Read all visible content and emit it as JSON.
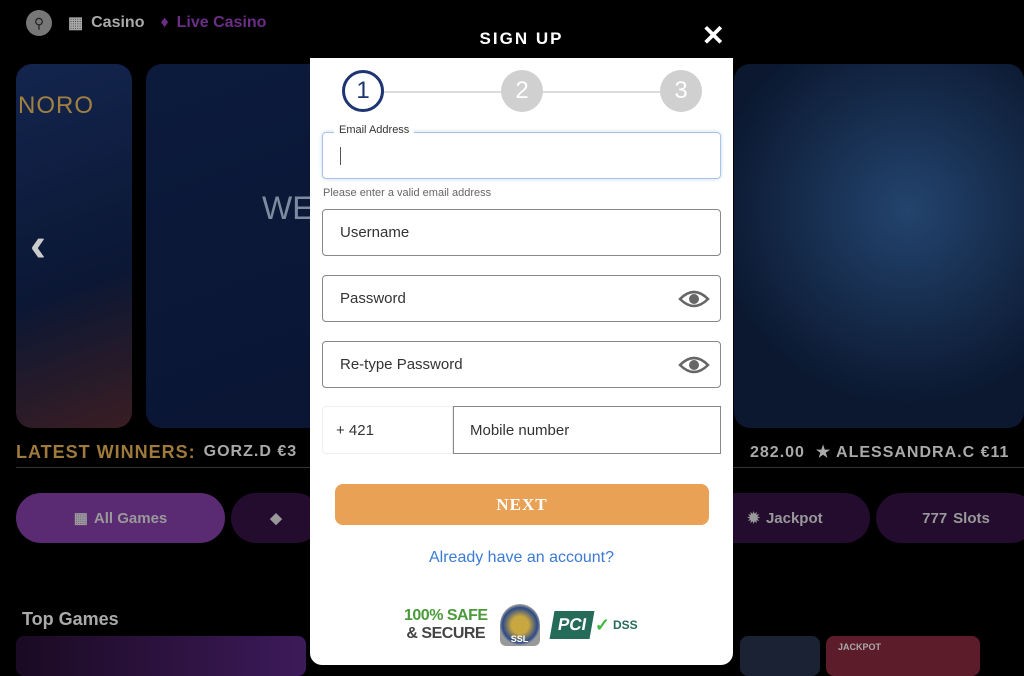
{
  "nav": {
    "items": [
      {
        "label": "Casino",
        "icon": "slot-machine-icon"
      },
      {
        "label": "Live Casino",
        "icon": "cards-icon"
      }
    ]
  },
  "background": {
    "banner_logo": "NORO",
    "banner_text": "WE",
    "winners_label": "LATEST WINNERS:",
    "winners_left": "GORZ.D €3",
    "winners_right_amount": "282.00",
    "winners_right_name": "ALESSANDRA.C €11",
    "categories": [
      "All Games",
      "",
      "Jackpot",
      "Slots"
    ],
    "top_games": "Top Games",
    "thumb_badge": "JACKPOT"
  },
  "modal": {
    "title": "SIGN UP",
    "steps": [
      "1",
      "2",
      "3"
    ],
    "current_step": 1,
    "email_label": "Email Address",
    "email_value": "",
    "email_hint": "Please enter a valid email address",
    "username_placeholder": "Username",
    "password_placeholder": "Password",
    "retype_placeholder": "Re-type Password",
    "phone_prefix": "+ 421",
    "mobile_placeholder": "Mobile number",
    "next_label": "NEXT",
    "login_link": "Already have an account?",
    "badges": {
      "safe_line1": "100% SAFE",
      "safe_line2": "& SECURE",
      "ssl": "SSL",
      "pci": "PCI",
      "dss": "DSS"
    }
  },
  "colors": {
    "accent": "#e9a155",
    "step_active": "#1d3570",
    "link": "#3a7bd5"
  }
}
